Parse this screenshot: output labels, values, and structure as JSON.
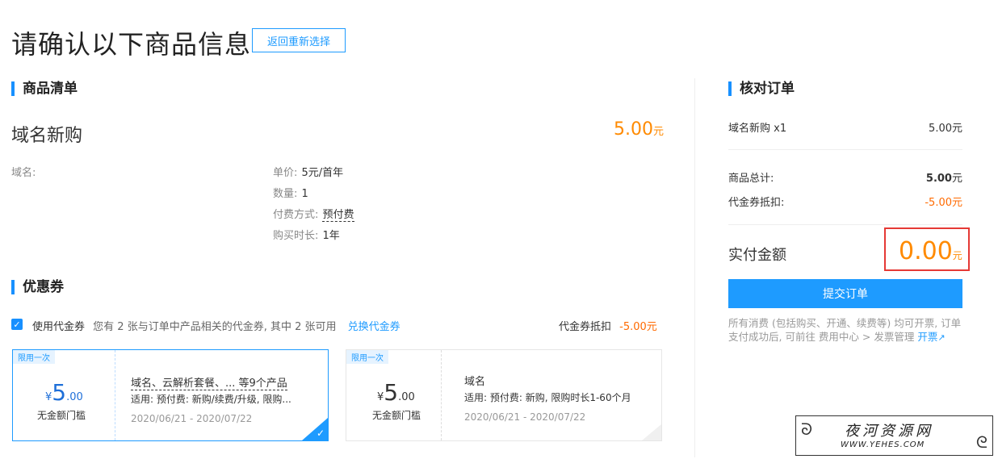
{
  "header": {
    "title": "请确认以下商品信息",
    "back_label": "返回重新选择"
  },
  "product_list": {
    "section_title": "商品清单",
    "name": "域名新购",
    "price": "5.00",
    "price_unit": "元",
    "domain_label": "域名:",
    "unit_price_label": "单价:",
    "unit_price_value": "5元/首年",
    "qty_label": "数量:",
    "qty_value": "1",
    "pay_label": "付费方式:",
    "pay_value": "预付费",
    "duration_label": "购买时长:",
    "duration_value": "1年"
  },
  "coupon": {
    "section_title": "优惠券",
    "use_label": "使用代金券",
    "desc": "您有 2 张与订单中产品相关的代金券, 其中 2 张可用",
    "exchange_link": "兑换代金券",
    "deduct_label": "代金券抵扣",
    "deduct_value": "-5.00元",
    "cards": [
      {
        "tag": "限用一次",
        "currency": "¥",
        "amount": "5",
        "cents": ".00",
        "threshold": "无金额门槛",
        "title": "域名、云解析套餐、... 等9个产品",
        "scope": "适用: 预付费: 新购/续费/升级, 限购...",
        "validity": "2020/06/21 - 2020/07/22",
        "selected": true
      },
      {
        "tag": "限用一次",
        "currency": "¥",
        "amount": "5",
        "cents": ".00",
        "threshold": "无金额门槛",
        "title": "域名",
        "scope": "适用: 预付费: 新购, 限购时长1-60个月",
        "validity": "2020/06/21 - 2020/07/22",
        "selected": false
      }
    ]
  },
  "order": {
    "section_title": "核对订单",
    "item_label": "域名新购 x1",
    "item_value": "5.00元",
    "subtotal_label": "商品总计:",
    "subtotal_value": "5.00",
    "subtotal_unit": "元",
    "discount_label": "代金券抵扣:",
    "discount_value": "-5.00元",
    "pay_label": "实付金额",
    "pay_value": "0.00",
    "pay_unit": "元",
    "submit_label": "提交订单",
    "note": "所有消费 (包括购买、开通、续费等) 均可开票, 订单支付成功后, 可前往 费用中心 > 发票管理",
    "invoice_link": "开票"
  },
  "watermark": {
    "title": "夜河资源网",
    "url": "WWW.YEHES.COM"
  },
  "colors": {
    "accent": "#1e9bff",
    "price": "#ff8a00",
    "discount": "#ff6a00",
    "highlight_box": "#e53935"
  }
}
